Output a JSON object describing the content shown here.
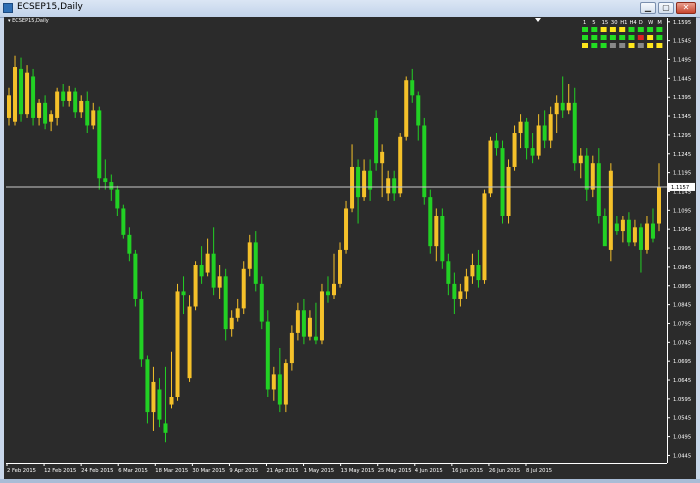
{
  "window": {
    "title": "ECSEP15,Daily"
  },
  "chart_header": {
    "label": "ECSEP15,Daily"
  },
  "price_line": {
    "value": "1.1157"
  },
  "colors": {
    "background": "#2b2b2b",
    "bull": "#f5c12a",
    "bear": "#22d124",
    "axis": "#ffffff",
    "price_line": "#c8c8c8"
  },
  "timeframe_panel": {
    "labels": [
      "1",
      "5",
      "15",
      "30",
      "H1",
      "H4",
      "D",
      "W",
      "M"
    ],
    "rows": [
      [
        "#22dd22",
        "#22dd22",
        "#ffe71c",
        "#ffe71c",
        "#ffe71c",
        "#22dd22",
        "#22dd22",
        "#22dd22",
        "#22dd22"
      ],
      [
        "#22dd22",
        "#22dd22",
        "#22dd22",
        "#22dd22",
        "#22dd22",
        "#22dd22",
        "#e02020",
        "#ffe71c",
        "#22dd22"
      ],
      [
        "#ffe71c",
        "#22dd22",
        "#22dd22",
        "#888888",
        "#888888",
        "#ffe71c",
        "#888888",
        "#ffe71c",
        "#ffe71c"
      ]
    ]
  },
  "chart_data": {
    "type": "candlestick",
    "x_tick_labels": [
      "2 Feb 2015",
      "12 Feb 2015",
      "24 Feb 2015",
      "6 Mar 2015",
      "18 Mar 2015",
      "30 Mar 2015",
      "9 Apr 2015",
      "21 Apr 2015",
      "1 May 2015",
      "13 May 2015",
      "25 May 2015",
      "4 Jun 2015",
      "16 Jun 2015",
      "26 Jun 2015",
      "8 Jul 2015"
    ],
    "y_tick_labels": [
      "1.1595",
      "1.1545",
      "1.1495",
      "1.1445",
      "1.1395",
      "1.1345",
      "1.1295",
      "1.1245",
      "1.1195",
      "1.1145",
      "1.1095",
      "1.1045",
      "1.0995",
      "1.0945",
      "1.0895",
      "1.0845",
      "1.0795",
      "1.0745",
      "1.0695",
      "1.0645",
      "1.0595",
      "1.0545",
      "1.0495",
      "1.0445"
    ],
    "ylim": [
      1.0425,
      1.1605
    ],
    "last_price": 1.1157,
    "candles": [
      {
        "o": 1.134,
        "h": 1.142,
        "l": 1.132,
        "c": 1.14
      },
      {
        "o": 1.133,
        "h": 1.1505,
        "l": 1.132,
        "c": 1.1475
      },
      {
        "o": 1.147,
        "h": 1.15,
        "l": 1.133,
        "c": 1.135
      },
      {
        "o": 1.135,
        "h": 1.148,
        "l": 1.134,
        "c": 1.146
      },
      {
        "o": 1.145,
        "h": 1.147,
        "l": 1.132,
        "c": 1.134
      },
      {
        "o": 1.134,
        "h": 1.139,
        "l": 1.132,
        "c": 1.138
      },
      {
        "o": 1.138,
        "h": 1.14,
        "l": 1.131,
        "c": 1.1325
      },
      {
        "o": 1.133,
        "h": 1.136,
        "l": 1.1305,
        "c": 1.135
      },
      {
        "o": 1.134,
        "h": 1.142,
        "l": 1.132,
        "c": 1.141
      },
      {
        "o": 1.141,
        "h": 1.143,
        "l": 1.137,
        "c": 1.1385
      },
      {
        "o": 1.1385,
        "h": 1.1425,
        "l": 1.137,
        "c": 1.141
      },
      {
        "o": 1.141,
        "h": 1.142,
        "l": 1.134,
        "c": 1.1355
      },
      {
        "o": 1.1355,
        "h": 1.14,
        "l": 1.134,
        "c": 1.1385
      },
      {
        "o": 1.1385,
        "h": 1.141,
        "l": 1.13,
        "c": 1.132
      },
      {
        "o": 1.132,
        "h": 1.138,
        "l": 1.131,
        "c": 1.136
      },
      {
        "o": 1.136,
        "h": 1.137,
        "l": 1.115,
        "c": 1.118
      },
      {
        "o": 1.118,
        "h": 1.123,
        "l": 1.115,
        "c": 1.117
      },
      {
        "o": 1.117,
        "h": 1.119,
        "l": 1.112,
        "c": 1.115
      },
      {
        "o": 1.115,
        "h": 1.116,
        "l": 1.108,
        "c": 1.11
      },
      {
        "o": 1.11,
        "h": 1.111,
        "l": 1.102,
        "c": 1.103
      },
      {
        "o": 1.103,
        "h": 1.105,
        "l": 1.096,
        "c": 1.098
      },
      {
        "o": 1.098,
        "h": 1.099,
        "l": 1.084,
        "c": 1.086
      },
      {
        "o": 1.086,
        "h": 1.088,
        "l": 1.068,
        "c": 1.07
      },
      {
        "o": 1.07,
        "h": 1.071,
        "l": 1.053,
        "c": 1.056
      },
      {
        "o": 1.056,
        "h": 1.068,
        "l": 1.051,
        "c": 1.064
      },
      {
        "o": 1.062,
        "h": 1.065,
        "l": 1.052,
        "c": 1.054
      },
      {
        "o": 1.053,
        "h": 1.068,
        "l": 1.048,
        "c": 1.0505
      },
      {
        "o": 1.058,
        "h": 1.072,
        "l": 1.057,
        "c": 1.06
      },
      {
        "o": 1.06,
        "h": 1.09,
        "l": 1.059,
        "c": 1.088
      },
      {
        "o": 1.088,
        "h": 1.092,
        "l": 1.082,
        "c": 1.087
      },
      {
        "o": 1.065,
        "h": 1.087,
        "l": 1.064,
        "c": 1.084
      },
      {
        "o": 1.084,
        "h": 1.096,
        "l": 1.083,
        "c": 1.095
      },
      {
        "o": 1.095,
        "h": 1.1,
        "l": 1.09,
        "c": 1.092
      },
      {
        "o": 1.093,
        "h": 1.102,
        "l": 1.092,
        "c": 1.098
      },
      {
        "o": 1.098,
        "h": 1.105,
        "l": 1.087,
        "c": 1.089
      },
      {
        "o": 1.089,
        "h": 1.095,
        "l": 1.086,
        "c": 1.092
      },
      {
        "o": 1.092,
        "h": 1.094,
        "l": 1.075,
        "c": 1.078
      },
      {
        "o": 1.078,
        "h": 1.083,
        "l": 1.076,
        "c": 1.081
      },
      {
        "o": 1.081,
        "h": 1.086,
        "l": 1.08,
        "c": 1.0835
      },
      {
        "o": 1.0835,
        "h": 1.096,
        "l": 1.082,
        "c": 1.094
      },
      {
        "o": 1.094,
        "h": 1.103,
        "l": 1.092,
        "c": 1.101
      },
      {
        "o": 1.101,
        "h": 1.104,
        "l": 1.088,
        "c": 1.09
      },
      {
        "o": 1.09,
        "h": 1.092,
        "l": 1.078,
        "c": 1.08
      },
      {
        "o": 1.08,
        "h": 1.083,
        "l": 1.06,
        "c": 1.062
      },
      {
        "o": 1.062,
        "h": 1.068,
        "l": 1.059,
        "c": 1.066
      },
      {
        "o": 1.066,
        "h": 1.073,
        "l": 1.056,
        "c": 1.058
      },
      {
        "o": 1.058,
        "h": 1.07,
        "l": 1.056,
        "c": 1.069
      },
      {
        "o": 1.069,
        "h": 1.079,
        "l": 1.067,
        "c": 1.077
      },
      {
        "o": 1.077,
        "h": 1.085,
        "l": 1.075,
        "c": 1.083
      },
      {
        "o": 1.083,
        "h": 1.086,
        "l": 1.074,
        "c": 1.076
      },
      {
        "o": 1.076,
        "h": 1.083,
        "l": 1.075,
        "c": 1.081
      },
      {
        "o": 1.076,
        "h": 1.085,
        "l": 1.074,
        "c": 1.075
      },
      {
        "o": 1.075,
        "h": 1.09,
        "l": 1.074,
        "c": 1.088
      },
      {
        "o": 1.088,
        "h": 1.092,
        "l": 1.085,
        "c": 1.087
      },
      {
        "o": 1.087,
        "h": 1.098,
        "l": 1.086,
        "c": 1.09
      },
      {
        "o": 1.09,
        "h": 1.101,
        "l": 1.089,
        "c": 1.099
      },
      {
        "o": 1.099,
        "h": 1.112,
        "l": 1.098,
        "c": 1.11
      },
      {
        "o": 1.11,
        "h": 1.127,
        "l": 1.109,
        "c": 1.121
      },
      {
        "o": 1.121,
        "h": 1.123,
        "l": 1.106,
        "c": 1.113
      },
      {
        "o": 1.113,
        "h": 1.123,
        "l": 1.112,
        "c": 1.12
      },
      {
        "o": 1.12,
        "h": 1.123,
        "l": 1.112,
        "c": 1.115
      },
      {
        "o": 1.134,
        "h": 1.136,
        "l": 1.12,
        "c": 1.122
      },
      {
        "o": 1.122,
        "h": 1.127,
        "l": 1.113,
        "c": 1.125
      },
      {
        "o": 1.114,
        "h": 1.12,
        "l": 1.112,
        "c": 1.118
      },
      {
        "o": 1.118,
        "h": 1.12,
        "l": 1.112,
        "c": 1.114
      },
      {
        "o": 1.114,
        "h": 1.13,
        "l": 1.113,
        "c": 1.129
      },
      {
        "o": 1.129,
        "h": 1.145,
        "l": 1.128,
        "c": 1.144
      },
      {
        "o": 1.144,
        "h": 1.147,
        "l": 1.138,
        "c": 1.14
      },
      {
        "o": 1.14,
        "h": 1.141,
        "l": 1.128,
        "c": 1.132
      },
      {
        "o": 1.132,
        "h": 1.134,
        "l": 1.111,
        "c": 1.113
      },
      {
        "o": 1.113,
        "h": 1.115,
        "l": 1.098,
        "c": 1.1
      },
      {
        "o": 1.1,
        "h": 1.11,
        "l": 1.096,
        "c": 1.108
      },
      {
        "o": 1.108,
        "h": 1.11,
        "l": 1.094,
        "c": 1.096
      },
      {
        "o": 1.096,
        "h": 1.098,
        "l": 1.087,
        "c": 1.09
      },
      {
        "o": 1.09,
        "h": 1.093,
        "l": 1.082,
        "c": 1.086
      },
      {
        "o": 1.086,
        "h": 1.09,
        "l": 1.084,
        "c": 1.088
      },
      {
        "o": 1.088,
        "h": 1.094,
        "l": 1.086,
        "c": 1.092
      },
      {
        "o": 1.092,
        "h": 1.098,
        "l": 1.09,
        "c": 1.095
      },
      {
        "o": 1.095,
        "h": 1.099,
        "l": 1.089,
        "c": 1.091
      },
      {
        "o": 1.091,
        "h": 1.115,
        "l": 1.09,
        "c": 1.114
      },
      {
        "o": 1.114,
        "h": 1.129,
        "l": 1.113,
        "c": 1.128
      },
      {
        "o": 1.128,
        "h": 1.13,
        "l": 1.124,
        "c": 1.126
      },
      {
        "o": 1.126,
        "h": 1.128,
        "l": 1.106,
        "c": 1.108
      },
      {
        "o": 1.108,
        "h": 1.123,
        "l": 1.106,
        "c": 1.121
      },
      {
        "o": 1.121,
        "h": 1.132,
        "l": 1.12,
        "c": 1.13
      },
      {
        "o": 1.13,
        "h": 1.135,
        "l": 1.126,
        "c": 1.133
      },
      {
        "o": 1.133,
        "h": 1.134,
        "l": 1.123,
        "c": 1.126
      },
      {
        "o": 1.126,
        "h": 1.13,
        "l": 1.122,
        "c": 1.124
      },
      {
        "o": 1.124,
        "h": 1.135,
        "l": 1.123,
        "c": 1.132
      },
      {
        "o": 1.132,
        "h": 1.136,
        "l": 1.126,
        "c": 1.128
      },
      {
        "o": 1.128,
        "h": 1.137,
        "l": 1.126,
        "c": 1.135
      },
      {
        "o": 1.135,
        "h": 1.14,
        "l": 1.13,
        "c": 1.138
      },
      {
        "o": 1.138,
        "h": 1.145,
        "l": 1.134,
        "c": 1.136
      },
      {
        "o": 1.136,
        "h": 1.143,
        "l": 1.135,
        "c": 1.138
      },
      {
        "o": 1.138,
        "h": 1.142,
        "l": 1.12,
        "c": 1.122
      },
      {
        "o": 1.122,
        "h": 1.126,
        "l": 1.118,
        "c": 1.124
      },
      {
        "o": 1.124,
        "h": 1.126,
        "l": 1.112,
        "c": 1.115
      },
      {
        "o": 1.115,
        "h": 1.124,
        "l": 1.113,
        "c": 1.122
      },
      {
        "o": 1.122,
        "h": 1.126,
        "l": 1.106,
        "c": 1.108
      },
      {
        "o": 1.108,
        "h": 1.11,
        "l": 1.101,
        "c": 1.1
      },
      {
        "o": 1.099,
        "h": 1.122,
        "l": 1.096,
        "c": 1.12
      },
      {
        "o": 1.106,
        "h": 1.108,
        "l": 1.103,
        "c": 1.104
      },
      {
        "o": 1.104,
        "h": 1.108,
        "l": 1.101,
        "c": 1.107
      },
      {
        "o": 1.107,
        "h": 1.109,
        "l": 1.1,
        "c": 1.101
      },
      {
        "o": 1.101,
        "h": 1.107,
        "l": 1.1,
        "c": 1.105
      },
      {
        "o": 1.105,
        "h": 1.106,
        "l": 1.093,
        "c": 1.099
      },
      {
        "o": 1.099,
        "h": 1.108,
        "l": 1.098,
        "c": 1.106
      },
      {
        "o": 1.106,
        "h": 1.11,
        "l": 1.101,
        "c": 1.102
      },
      {
        "o": 1.106,
        "h": 1.122,
        "l": 1.104,
        "c": 1.1157
      }
    ]
  }
}
